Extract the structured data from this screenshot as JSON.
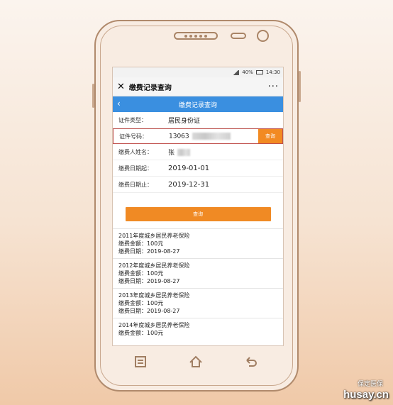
{
  "status": {
    "battery": "40%",
    "time": "14:30"
  },
  "wechat": {
    "close_icon": "✕",
    "title": "缴费记录查询",
    "more_icon": "···"
  },
  "subheader": {
    "back_icon": "‹",
    "title": "缴费记录查询"
  },
  "form": {
    "id_type_label": "证件类型：",
    "id_type_value": "居民身份证",
    "id_no_label": "证件号码：",
    "id_no_value": "13063",
    "query_small": "查询",
    "name_label": "缴费人姓名：",
    "name_value": "张",
    "start_label": "缴费日期起：",
    "start_value": "2019-01-01",
    "end_label": "缴费日期止：",
    "end_value": "2019-12-31",
    "query_big": "查询"
  },
  "records": [
    {
      "title": "2011年度城乡居民养老保险",
      "amount": "缴费金额：100元",
      "date": "缴费日期：2019-08-27"
    },
    {
      "title": "2012年度城乡居民养老保险",
      "amount": "缴费金额：100元",
      "date": "缴费日期：2019-08-27"
    },
    {
      "title": "2013年度城乡居民养老保险",
      "amount": "缴费金额：100元",
      "date": "缴费日期：2019-08-27"
    },
    {
      "title": "2014年度城乡居民养老保险",
      "amount": "缴费金额：100元",
      "date": ""
    }
  ],
  "watermark": {
    "top": "保定医保",
    "main": "husay.cn"
  }
}
